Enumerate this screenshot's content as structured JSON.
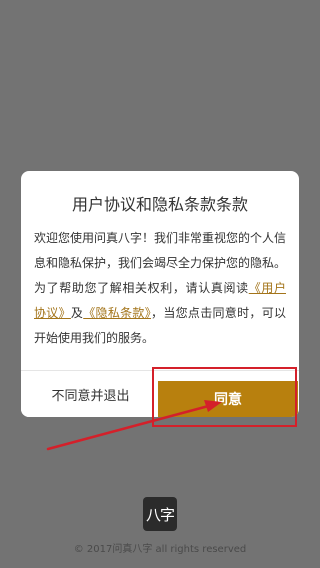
{
  "dialog": {
    "title": "用户协议和隐私条款条款",
    "body": {
      "intro": "欢迎您使用问真八字！我们非常重视您的个人信息和隐私保护，我们会竭尽全力保护您的隐私。为了帮助您了解相关权利，请认真阅读",
      "user_agreement_link": "《用户协议》",
      "and": "及",
      "privacy_link": "《隐私条款》",
      "outro": "，当您点击同意时，可以开始使用我们的服务。"
    },
    "buttons": {
      "disagree": "不同意并退出",
      "agree": "同意"
    }
  },
  "app": {
    "logo_text": "八字",
    "copyright": "© 2017问真八字 all rights reserved"
  },
  "colors": {
    "overlay": "#737373",
    "accent": "#b8800e",
    "link": "#a3741a",
    "annotation": "#d4202a"
  }
}
